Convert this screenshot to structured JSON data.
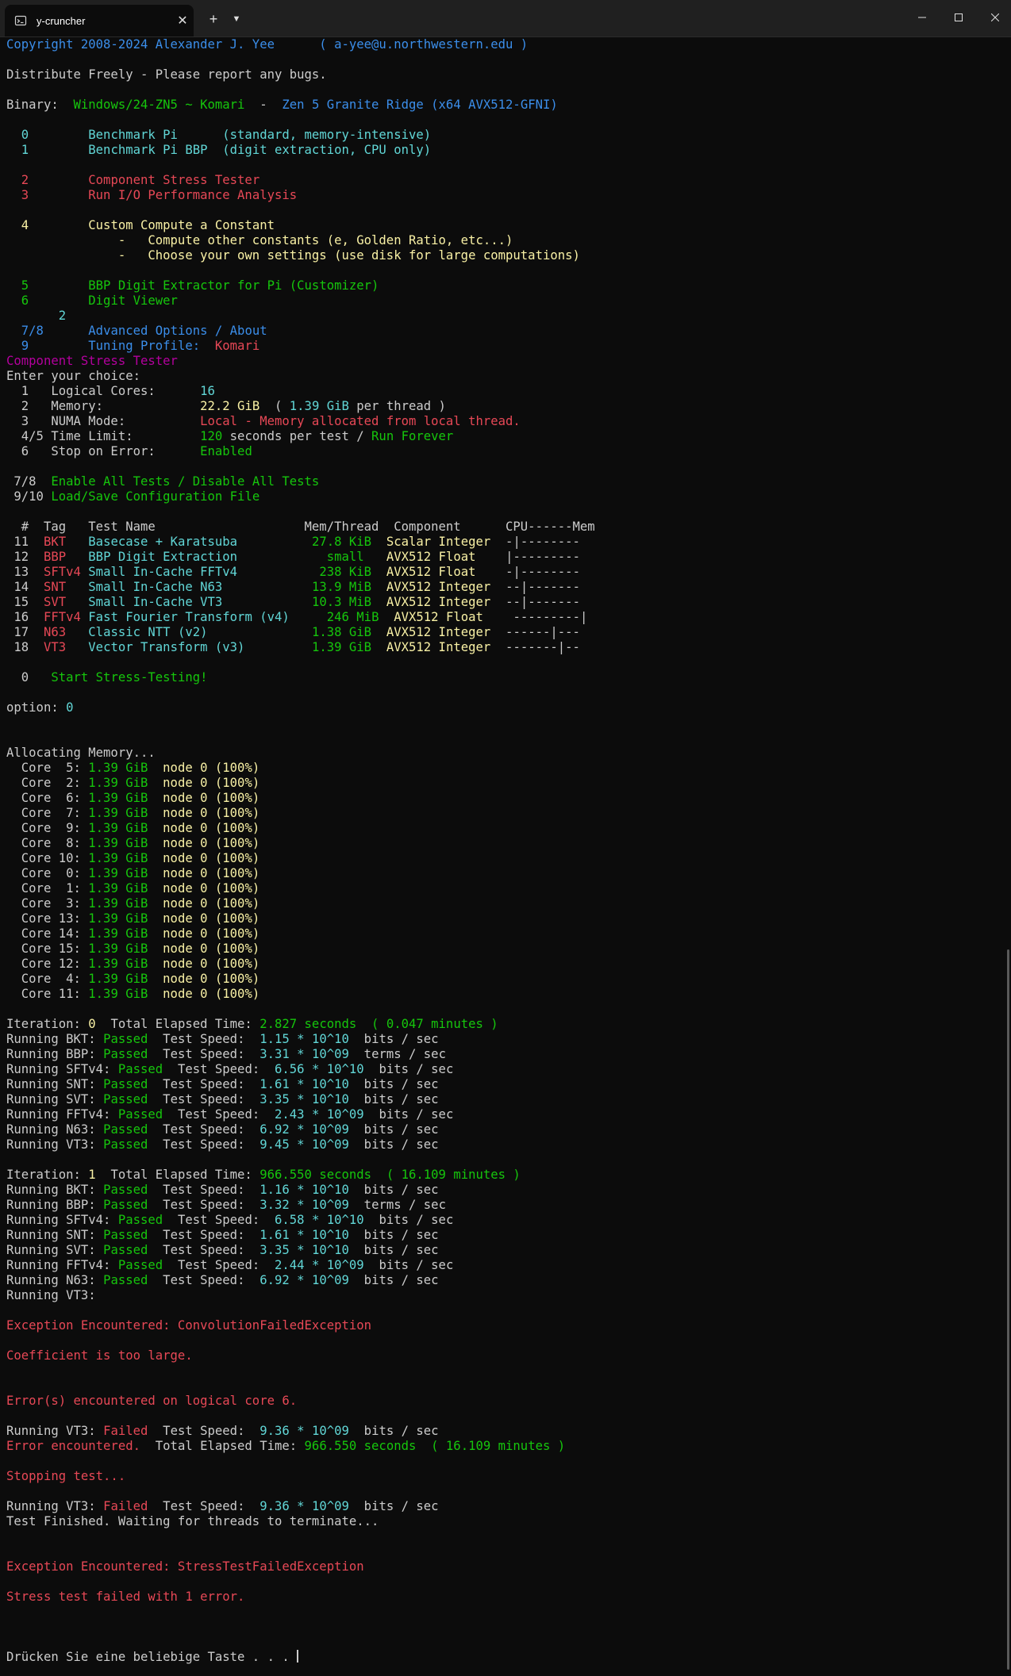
{
  "window": {
    "tab_title": "y-cruncher",
    "tab_icon": "terminal-icon",
    "controls": [
      "minimize-icon",
      "maximize-icon",
      "close-icon"
    ]
  },
  "colors": {
    "W": "#cccccc",
    "C": "#61d6d6",
    "B": "#3b8eea",
    "R": "#e74856",
    "G": "#16c60c",
    "Y": "#f9f1a5",
    "M": "#b4009e"
  },
  "lines": [
    [
      [
        "B",
        "Copyright 2008-2024 Alexander J. Yee      ( a-yee@u.northwestern.edu )"
      ]
    ],
    [],
    [
      [
        "W",
        "Distribute Freely - Please report any bugs."
      ]
    ],
    [],
    [
      [
        "W",
        "Binary:  "
      ],
      [
        "G",
        "Windows/24-ZN5 ~ Komari"
      ],
      [
        "W",
        "  -  "
      ],
      [
        "B",
        "Zen 5 Granite Ridge (x64 AVX512-GFNI)"
      ]
    ],
    [],
    [
      [
        "W",
        "  "
      ],
      [
        "C",
        "0"
      ],
      [
        "W",
        "        "
      ],
      [
        "C",
        "Benchmark Pi      (standard, memory-intensive)"
      ]
    ],
    [
      [
        "W",
        "  "
      ],
      [
        "C",
        "1"
      ],
      [
        "W",
        "        "
      ],
      [
        "C",
        "Benchmark Pi BBP  (digit extraction, CPU only)"
      ]
    ],
    [],
    [
      [
        "W",
        "  "
      ],
      [
        "R",
        "2"
      ],
      [
        "W",
        "        "
      ],
      [
        "R",
        "Component Stress Tester"
      ]
    ],
    [
      [
        "W",
        "  "
      ],
      [
        "R",
        "3"
      ],
      [
        "W",
        "        "
      ],
      [
        "R",
        "Run I/O Performance Analysis"
      ]
    ],
    [],
    [
      [
        "W",
        "  "
      ],
      [
        "Y",
        "4"
      ],
      [
        "W",
        "        "
      ],
      [
        "Y",
        "Custom Compute a Constant"
      ]
    ],
    [
      [
        "Y",
        "               -   Compute other constants (e, Golden Ratio, etc...)"
      ]
    ],
    [
      [
        "Y",
        "               -   Choose your own settings (use disk for large computations)"
      ]
    ],
    [],
    [
      [
        "W",
        "  "
      ],
      [
        "G",
        "5"
      ],
      [
        "W",
        "        "
      ],
      [
        "G",
        "BBP Digit Extractor for Pi (Customizer)"
      ]
    ],
    [
      [
        "W",
        "  "
      ],
      [
        "G",
        "6"
      ],
      [
        "W",
        "        "
      ],
      [
        "G",
        "Digit Viewer"
      ]
    ],
    [
      [
        "W",
        "       "
      ],
      [
        "C",
        "2"
      ]
    ],
    [
      [
        "W",
        "  "
      ],
      [
        "B",
        "7/8"
      ],
      [
        "W",
        "      "
      ],
      [
        "B",
        "Advanced Options / About"
      ]
    ],
    [
      [
        "W",
        "  "
      ],
      [
        "B",
        "9"
      ],
      [
        "W",
        "        "
      ],
      [
        "B",
        "Tuning Profile:  "
      ],
      [
        "R",
        "Komari"
      ]
    ],
    [
      [
        "M",
        "Component Stress Tester"
      ]
    ],
    [
      [
        "W",
        "Enter your choice:"
      ]
    ],
    [
      [
        "W",
        "  1   Logical Cores:      "
      ],
      [
        "C",
        "16"
      ]
    ],
    [
      [
        "W",
        "  2   Memory:             "
      ],
      [
        "Y",
        "22.2 GiB"
      ],
      [
        "W",
        "  ( "
      ],
      [
        "C",
        "1.39 GiB"
      ],
      [
        "W",
        " per thread )"
      ]
    ],
    [
      [
        "W",
        "  3   NUMA Mode:          "
      ],
      [
        "R",
        "Local - Memory allocated from local thread."
      ]
    ],
    [
      [
        "W",
        "  4/5 Time Limit:         "
      ],
      [
        "G",
        "120"
      ],
      [
        "W",
        " seconds per test / "
      ],
      [
        "G",
        "Run Forever"
      ]
    ],
    [
      [
        "W",
        "  6   Stop on Error:      "
      ],
      [
        "G",
        "Enabled"
      ]
    ],
    [],
    [
      [
        "W",
        " 7/8  "
      ],
      [
        "G",
        "Enable All Tests / Disable All Tests"
      ]
    ],
    [
      [
        "W",
        " 9/10 "
      ],
      [
        "G",
        "Load/Save Configuration File"
      ]
    ],
    [],
    [
      [
        "W",
        "  #  Tag   Test Name                    Mem/Thread  Component      CPU------Mem"
      ]
    ],
    [
      [
        "W",
        " 11  "
      ],
      [
        "R",
        "BKT"
      ],
      [
        "W",
        "   "
      ],
      [
        "C",
        "Basecase + Karatsuba"
      ],
      [
        "W",
        "          "
      ],
      [
        "G",
        "27.8 KiB"
      ],
      [
        "W",
        "  "
      ],
      [
        "Y",
        "Scalar Integer"
      ],
      [
        "W",
        "  -|--------"
      ]
    ],
    [
      [
        "W",
        " 12  "
      ],
      [
        "R",
        "BBP"
      ],
      [
        "W",
        "   "
      ],
      [
        "C",
        "BBP Digit Extraction"
      ],
      [
        "W",
        "            "
      ],
      [
        "G",
        "small"
      ],
      [
        "W",
        "   "
      ],
      [
        "Y",
        "AVX512 Float"
      ],
      [
        "W",
        "    |---------"
      ]
    ],
    [
      [
        "W",
        " 13  "
      ],
      [
        "R",
        "SFTv4"
      ],
      [
        "W",
        " "
      ],
      [
        "C",
        "Small In-Cache FFTv4"
      ],
      [
        "W",
        "           "
      ],
      [
        "G",
        "238 KiB"
      ],
      [
        "W",
        "  "
      ],
      [
        "Y",
        "AVX512 Float"
      ],
      [
        "W",
        "    -|--------"
      ]
    ],
    [
      [
        "W",
        " 14  "
      ],
      [
        "R",
        "SNT"
      ],
      [
        "W",
        "   "
      ],
      [
        "C",
        "Small In-Cache N63"
      ],
      [
        "W",
        "            "
      ],
      [
        "G",
        "13.9 MiB"
      ],
      [
        "W",
        "  "
      ],
      [
        "Y",
        "AVX512 Integer"
      ],
      [
        "W",
        "  --|-------"
      ]
    ],
    [
      [
        "W",
        " 15  "
      ],
      [
        "R",
        "SVT"
      ],
      [
        "W",
        "   "
      ],
      [
        "C",
        "Small In-Cache VT3"
      ],
      [
        "W",
        "            "
      ],
      [
        "G",
        "10.3 MiB"
      ],
      [
        "W",
        "  "
      ],
      [
        "Y",
        "AVX512 Integer"
      ],
      [
        "W",
        "  --|-------"
      ]
    ],
    [
      [
        "W",
        " 16  "
      ],
      [
        "R",
        "FFTv4"
      ],
      [
        "W",
        " "
      ],
      [
        "C",
        "Fast Fourier Transform (v4)"
      ],
      [
        "W",
        "     "
      ],
      [
        "G",
        "246 MiB"
      ],
      [
        "W",
        "  "
      ],
      [
        "Y",
        "AVX512 Float"
      ],
      [
        "W",
        "    ---------|"
      ]
    ],
    [
      [
        "W",
        " 17  "
      ],
      [
        "R",
        "N63"
      ],
      [
        "W",
        "   "
      ],
      [
        "C",
        "Classic NTT (v2)"
      ],
      [
        "W",
        "              "
      ],
      [
        "G",
        "1.38 GiB"
      ],
      [
        "W",
        "  "
      ],
      [
        "Y",
        "AVX512 Integer"
      ],
      [
        "W",
        "  ------|---"
      ]
    ],
    [
      [
        "W",
        " 18  "
      ],
      [
        "R",
        "VT3"
      ],
      [
        "W",
        "   "
      ],
      [
        "C",
        "Vector Transform (v3)"
      ],
      [
        "W",
        "         "
      ],
      [
        "G",
        "1.39 GiB"
      ],
      [
        "W",
        "  "
      ],
      [
        "Y",
        "AVX512 Integer"
      ],
      [
        "W",
        "  -------|--"
      ]
    ],
    [],
    [
      [
        "W",
        "  0   "
      ],
      [
        "G",
        "Start Stress-Testing!"
      ]
    ],
    [],
    [
      [
        "W",
        "option: "
      ],
      [
        "C",
        "0"
      ]
    ],
    [],
    [],
    [
      [
        "W",
        "Allocating Memory..."
      ]
    ],
    [
      [
        "W",
        "  Core  5: "
      ],
      [
        "G",
        "1.39 GiB"
      ],
      [
        "W",
        "  "
      ],
      [
        "Y",
        "node 0 (100%)"
      ]
    ],
    [
      [
        "W",
        "  Core  2: "
      ],
      [
        "G",
        "1.39 GiB"
      ],
      [
        "W",
        "  "
      ],
      [
        "Y",
        "node 0 (100%)"
      ]
    ],
    [
      [
        "W",
        "  Core  6: "
      ],
      [
        "G",
        "1.39 GiB"
      ],
      [
        "W",
        "  "
      ],
      [
        "Y",
        "node 0 (100%)"
      ]
    ],
    [
      [
        "W",
        "  Core  7: "
      ],
      [
        "G",
        "1.39 GiB"
      ],
      [
        "W",
        "  "
      ],
      [
        "Y",
        "node 0 (100%)"
      ]
    ],
    [
      [
        "W",
        "  Core  9: "
      ],
      [
        "G",
        "1.39 GiB"
      ],
      [
        "W",
        "  "
      ],
      [
        "Y",
        "node 0 (100%)"
      ]
    ],
    [
      [
        "W",
        "  Core  8: "
      ],
      [
        "G",
        "1.39 GiB"
      ],
      [
        "W",
        "  "
      ],
      [
        "Y",
        "node 0 (100%)"
      ]
    ],
    [
      [
        "W",
        "  Core 10: "
      ],
      [
        "G",
        "1.39 GiB"
      ],
      [
        "W",
        "  "
      ],
      [
        "Y",
        "node 0 (100%)"
      ]
    ],
    [
      [
        "W",
        "  Core  0: "
      ],
      [
        "G",
        "1.39 GiB"
      ],
      [
        "W",
        "  "
      ],
      [
        "Y",
        "node 0 (100%)"
      ]
    ],
    [
      [
        "W",
        "  Core  1: "
      ],
      [
        "G",
        "1.39 GiB"
      ],
      [
        "W",
        "  "
      ],
      [
        "Y",
        "node 0 (100%)"
      ]
    ],
    [
      [
        "W",
        "  Core  3: "
      ],
      [
        "G",
        "1.39 GiB"
      ],
      [
        "W",
        "  "
      ],
      [
        "Y",
        "node 0 (100%)"
      ]
    ],
    [
      [
        "W",
        "  Core 13: "
      ],
      [
        "G",
        "1.39 GiB"
      ],
      [
        "W",
        "  "
      ],
      [
        "Y",
        "node 0 (100%)"
      ]
    ],
    [
      [
        "W",
        "  Core 14: "
      ],
      [
        "G",
        "1.39 GiB"
      ],
      [
        "W",
        "  "
      ],
      [
        "Y",
        "node 0 (100%)"
      ]
    ],
    [
      [
        "W",
        "  Core 15: "
      ],
      [
        "G",
        "1.39 GiB"
      ],
      [
        "W",
        "  "
      ],
      [
        "Y",
        "node 0 (100%)"
      ]
    ],
    [
      [
        "W",
        "  Core 12: "
      ],
      [
        "G",
        "1.39 GiB"
      ],
      [
        "W",
        "  "
      ],
      [
        "Y",
        "node 0 (100%)"
      ]
    ],
    [
      [
        "W",
        "  Core  4: "
      ],
      [
        "G",
        "1.39 GiB"
      ],
      [
        "W",
        "  "
      ],
      [
        "Y",
        "node 0 (100%)"
      ]
    ],
    [
      [
        "W",
        "  Core 11: "
      ],
      [
        "G",
        "1.39 GiB"
      ],
      [
        "W",
        "  "
      ],
      [
        "Y",
        "node 0 (100%)"
      ]
    ],
    [],
    [
      [
        "W",
        "Iteration: "
      ],
      [
        "Y",
        "0"
      ],
      [
        "W",
        "  Total Elapsed Time: "
      ],
      [
        "G",
        "2.827 seconds  ( 0.047 minutes )"
      ]
    ],
    [
      [
        "W",
        "Running BKT: "
      ],
      [
        "G",
        "Passed"
      ],
      [
        "W",
        "  Test Speed:  "
      ],
      [
        "C",
        "1.15 * 10^10"
      ],
      [
        "W",
        "  bits / sec"
      ]
    ],
    [
      [
        "W",
        "Running BBP: "
      ],
      [
        "G",
        "Passed"
      ],
      [
        "W",
        "  Test Speed:  "
      ],
      [
        "C",
        "3.31 * 10^09"
      ],
      [
        "W",
        "  terms / sec"
      ]
    ],
    [
      [
        "W",
        "Running SFTv4: "
      ],
      [
        "G",
        "Passed"
      ],
      [
        "W",
        "  Test Speed:  "
      ],
      [
        "C",
        "6.56 * 10^10"
      ],
      [
        "W",
        "  bits / sec"
      ]
    ],
    [
      [
        "W",
        "Running SNT: "
      ],
      [
        "G",
        "Passed"
      ],
      [
        "W",
        "  Test Speed:  "
      ],
      [
        "C",
        "1.61 * 10^10"
      ],
      [
        "W",
        "  bits / sec"
      ]
    ],
    [
      [
        "W",
        "Running SVT: "
      ],
      [
        "G",
        "Passed"
      ],
      [
        "W",
        "  Test Speed:  "
      ],
      [
        "C",
        "3.35 * 10^10"
      ],
      [
        "W",
        "  bits / sec"
      ]
    ],
    [
      [
        "W",
        "Running FFTv4: "
      ],
      [
        "G",
        "Passed"
      ],
      [
        "W",
        "  Test Speed:  "
      ],
      [
        "C",
        "2.43 * 10^09"
      ],
      [
        "W",
        "  bits / sec"
      ]
    ],
    [
      [
        "W",
        "Running N63: "
      ],
      [
        "G",
        "Passed"
      ],
      [
        "W",
        "  Test Speed:  "
      ],
      [
        "C",
        "6.92 * 10^09"
      ],
      [
        "W",
        "  bits / sec"
      ]
    ],
    [
      [
        "W",
        "Running VT3: "
      ],
      [
        "G",
        "Passed"
      ],
      [
        "W",
        "  Test Speed:  "
      ],
      [
        "C",
        "9.45 * 10^09"
      ],
      [
        "W",
        "  bits / sec"
      ]
    ],
    [],
    [
      [
        "W",
        "Iteration: "
      ],
      [
        "Y",
        "1"
      ],
      [
        "W",
        "  Total Elapsed Time: "
      ],
      [
        "G",
        "966.550 seconds  ( 16.109 minutes )"
      ]
    ],
    [
      [
        "W",
        "Running BKT: "
      ],
      [
        "G",
        "Passed"
      ],
      [
        "W",
        "  Test Speed:  "
      ],
      [
        "C",
        "1.16 * 10^10"
      ],
      [
        "W",
        "  bits / sec"
      ]
    ],
    [
      [
        "W",
        "Running BBP: "
      ],
      [
        "G",
        "Passed"
      ],
      [
        "W",
        "  Test Speed:  "
      ],
      [
        "C",
        "3.32 * 10^09"
      ],
      [
        "W",
        "  terms / sec"
      ]
    ],
    [
      [
        "W",
        "Running SFTv4: "
      ],
      [
        "G",
        "Passed"
      ],
      [
        "W",
        "  Test Speed:  "
      ],
      [
        "C",
        "6.58 * 10^10"
      ],
      [
        "W",
        "  bits / sec"
      ]
    ],
    [
      [
        "W",
        "Running SNT: "
      ],
      [
        "G",
        "Passed"
      ],
      [
        "W",
        "  Test Speed:  "
      ],
      [
        "C",
        "1.61 * 10^10"
      ],
      [
        "W",
        "  bits / sec"
      ]
    ],
    [
      [
        "W",
        "Running SVT: "
      ],
      [
        "G",
        "Passed"
      ],
      [
        "W",
        "  Test Speed:  "
      ],
      [
        "C",
        "3.35 * 10^10"
      ],
      [
        "W",
        "  bits / sec"
      ]
    ],
    [
      [
        "W",
        "Running FFTv4: "
      ],
      [
        "G",
        "Passed"
      ],
      [
        "W",
        "  Test Speed:  "
      ],
      [
        "C",
        "2.44 * 10^09"
      ],
      [
        "W",
        "  bits / sec"
      ]
    ],
    [
      [
        "W",
        "Running N63: "
      ],
      [
        "G",
        "Passed"
      ],
      [
        "W",
        "  Test Speed:  "
      ],
      [
        "C",
        "6.92 * 10^09"
      ],
      [
        "W",
        "  bits / sec"
      ]
    ],
    [
      [
        "W",
        "Running VT3:"
      ]
    ],
    [],
    [
      [
        "R",
        "Exception Encountered: ConvolutionFailedException"
      ]
    ],
    [],
    [
      [
        "R",
        "Coefficient is too large."
      ]
    ],
    [],
    [],
    [
      [
        "R",
        "Error(s) encountered on logical core 6."
      ]
    ],
    [],
    [
      [
        "W",
        "Running VT3: "
      ],
      [
        "R",
        "Failed"
      ],
      [
        "W",
        "  Test Speed:  "
      ],
      [
        "C",
        "9.36 * 10^09"
      ],
      [
        "W",
        "  bits / sec"
      ]
    ],
    [
      [
        "R",
        "Error encountered."
      ],
      [
        "W",
        "  Total Elapsed Time: "
      ],
      [
        "G",
        "966.550 seconds  ( 16.109 minutes )"
      ]
    ],
    [],
    [
      [
        "R",
        "Stopping test..."
      ]
    ],
    [],
    [
      [
        "W",
        "Running VT3: "
      ],
      [
        "R",
        "Failed"
      ],
      [
        "W",
        "  Test Speed:  "
      ],
      [
        "C",
        "9.36 * 10^09"
      ],
      [
        "W",
        "  bits / sec"
      ]
    ],
    [
      [
        "W",
        "Test Finished. Waiting for threads to terminate..."
      ]
    ],
    [],
    [],
    [
      [
        "R",
        "Exception Encountered: StressTestFailedException"
      ]
    ],
    [],
    [
      [
        "R",
        "Stress test failed with 1 error."
      ]
    ],
    [],
    [],
    [],
    [
      [
        "W",
        "Drücken Sie eine beliebige Taste . . . "
      ]
    ]
  ]
}
